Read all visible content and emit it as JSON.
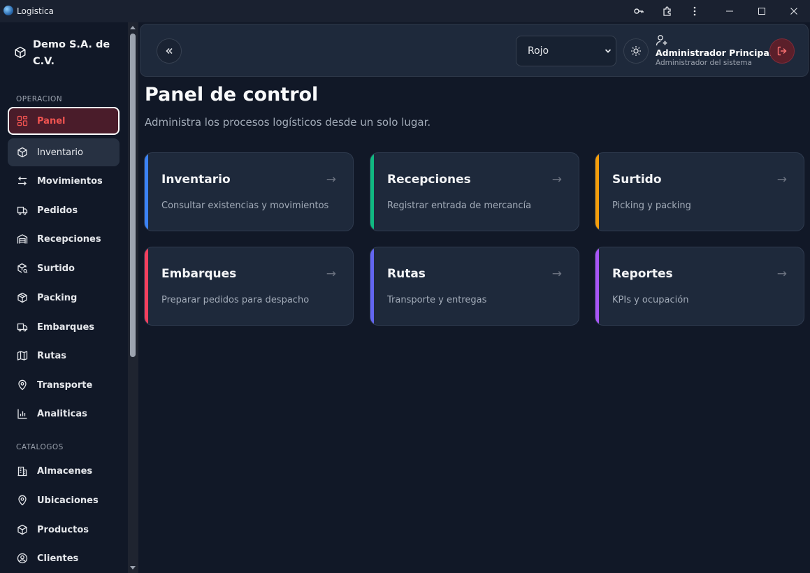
{
  "window": {
    "title": "Logistica"
  },
  "sidebar": {
    "company_name": "Demo S.A. de C.V.",
    "sections": [
      {
        "label": "OPERACION",
        "items": [
          {
            "label": "Panel",
            "icon": "dashboard-icon",
            "state": "active"
          },
          {
            "label": "Inventario",
            "icon": "box-icon",
            "state": "hover"
          },
          {
            "label": "Movimientos",
            "icon": "arrows-swap-icon",
            "state": ""
          },
          {
            "label": "Pedidos",
            "icon": "truck-icon",
            "state": ""
          },
          {
            "label": "Recepciones",
            "icon": "warehouse-icon",
            "state": ""
          },
          {
            "label": "Surtido",
            "icon": "box-search-icon",
            "state": ""
          },
          {
            "label": "Packing",
            "icon": "box-icon",
            "state": ""
          },
          {
            "label": "Embarques",
            "icon": "truck-icon",
            "state": ""
          },
          {
            "label": "Rutas",
            "icon": "map-icon",
            "state": ""
          },
          {
            "label": "Transporte",
            "icon": "map-pin-icon",
            "state": ""
          },
          {
            "label": "Analiticas",
            "icon": "bar-chart-icon",
            "state": ""
          }
        ]
      },
      {
        "label": "CATALOGOS",
        "items": [
          {
            "label": "Almacenes",
            "icon": "building-icon",
            "state": ""
          },
          {
            "label": "Ubicaciones",
            "icon": "map-pin-icon",
            "state": ""
          },
          {
            "label": "Productos",
            "icon": "box-icon",
            "state": ""
          },
          {
            "label": "Clientes",
            "icon": "user-circle-icon",
            "state": ""
          }
        ]
      }
    ]
  },
  "header": {
    "theme_select_value": "Rojo",
    "user_name": "Administrador Principal",
    "user_role": "Administrador del sistema"
  },
  "main": {
    "title": "Panel de control",
    "subtitle": "Administra los procesos logísticos desde un solo lugar.",
    "cards": [
      {
        "title": "Inventario",
        "description": "Consultar existencias y movimientos",
        "accent": "#3b82f6",
        "arrow": "→"
      },
      {
        "title": "Recepciones",
        "description": "Registrar entrada de mercancía",
        "accent": "#10b981",
        "arrow": "→"
      },
      {
        "title": "Surtido",
        "description": "Picking y packing",
        "accent": "#f59e0b",
        "arrow": "→"
      },
      {
        "title": "Embarques",
        "description": "Preparar pedidos para despacho",
        "accent": "#f43f5e",
        "arrow": "→"
      },
      {
        "title": "Rutas",
        "description": "Transporte y entregas",
        "accent": "#6366f1",
        "arrow": "→"
      },
      {
        "title": "Reportes",
        "description": "KPIs y ocupación",
        "accent": "#a855f7",
        "arrow": "→"
      }
    ]
  },
  "colors": {
    "active_nav_bg": "#4a1c2a",
    "active_nav_text": "#ef5350",
    "background": "#111827",
    "card_bg": "#1e293b"
  }
}
